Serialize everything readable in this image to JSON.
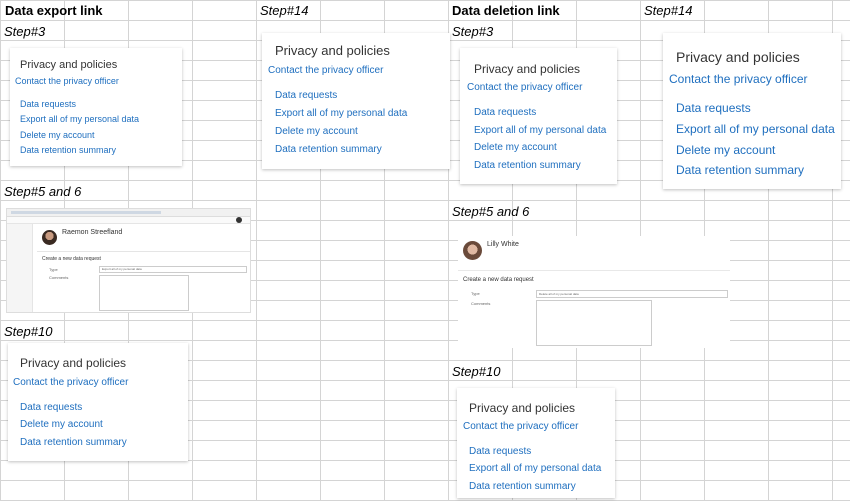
{
  "columns": {
    "export_header": "Data export link",
    "deletion_header": "Data deletion link",
    "step14_a": "Step#14",
    "step14_b": "Step#14"
  },
  "steps": {
    "step3": "Step#3",
    "step5_6": "Step#5 and 6",
    "step10": "Step#10"
  },
  "panel": {
    "title": "Privacy and policies",
    "contact": "Contact the privacy officer",
    "data_requests": "Data requests",
    "export": "Export all of my personal data",
    "delete": "Delete my account",
    "retention": "Data retention summary"
  },
  "form_export": {
    "user_name": "Raemon Streefland",
    "heading": "Create a new data request",
    "type_label": "Type",
    "comments_label": "Comments",
    "type_value": "Export all of my personal data"
  },
  "form_delete": {
    "user_name": "Lilly White",
    "heading": "Create a new data request",
    "type_label": "Type",
    "comments_label": "Comments",
    "type_value": "Delete all of my personal data"
  }
}
